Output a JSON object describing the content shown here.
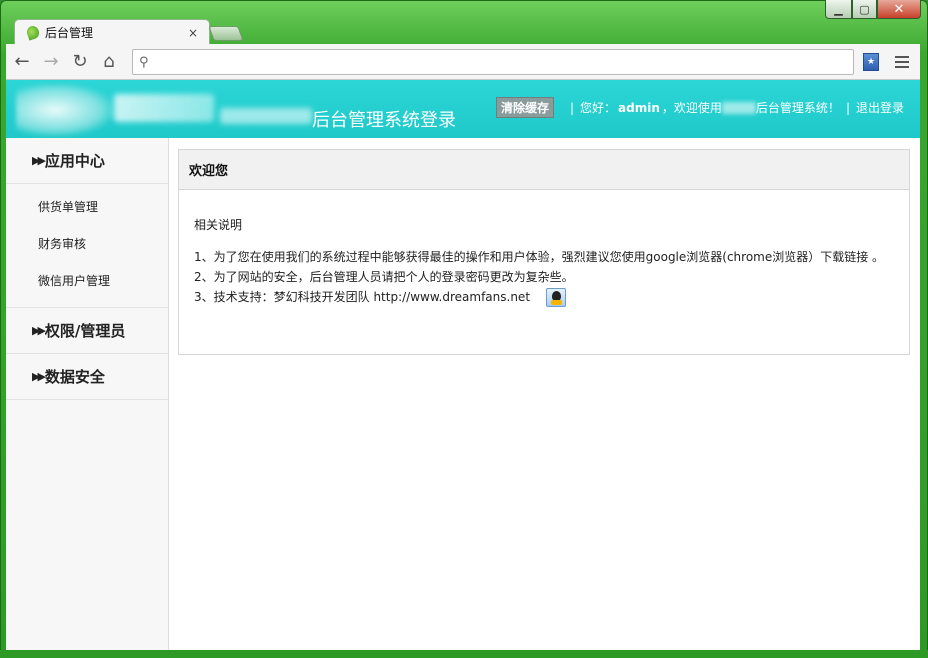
{
  "browser": {
    "tab_title": "后台管理",
    "tab_close": "×",
    "address_value": "",
    "window_controls": {
      "minimize": "▁",
      "maximize": "▢",
      "close": "✕"
    }
  },
  "header": {
    "system_title": "后台管理系统登录",
    "clear_cache": "清除缓存",
    "separator": "|",
    "greeting_prefix": "您好：",
    "username": "admin",
    "welcome_prefix": "，欢迎使用",
    "welcome_suffix": "后台管理系统！",
    "logout": "退出登录"
  },
  "sidebar": {
    "groups": [
      {
        "label": "应用中心",
        "items": [
          "供货单管理",
          "财务审核",
          "微信用户管理"
        ]
      },
      {
        "label": "权限/管理员"
      },
      {
        "label": "数据安全"
      }
    ]
  },
  "panel": {
    "title": "欢迎您",
    "desc_title": "相关说明",
    "notes": [
      "1、为了您在使用我们的系统过程中能够获得最佳的操作和用户体验，强烈建议您使用google浏览器(chrome浏览器）下载链接  。",
      "2、为了网站的安全，后台管理人员请把个人的登录密码更改为复杂些。",
      "3、技术支持：梦幻科技开发团队    http://www.dreamfans.net"
    ]
  },
  "colors": {
    "header_bg": "#22cfcf",
    "frame_green": "#3aa82f",
    "sidebar_bg": "#f7f7f7"
  }
}
